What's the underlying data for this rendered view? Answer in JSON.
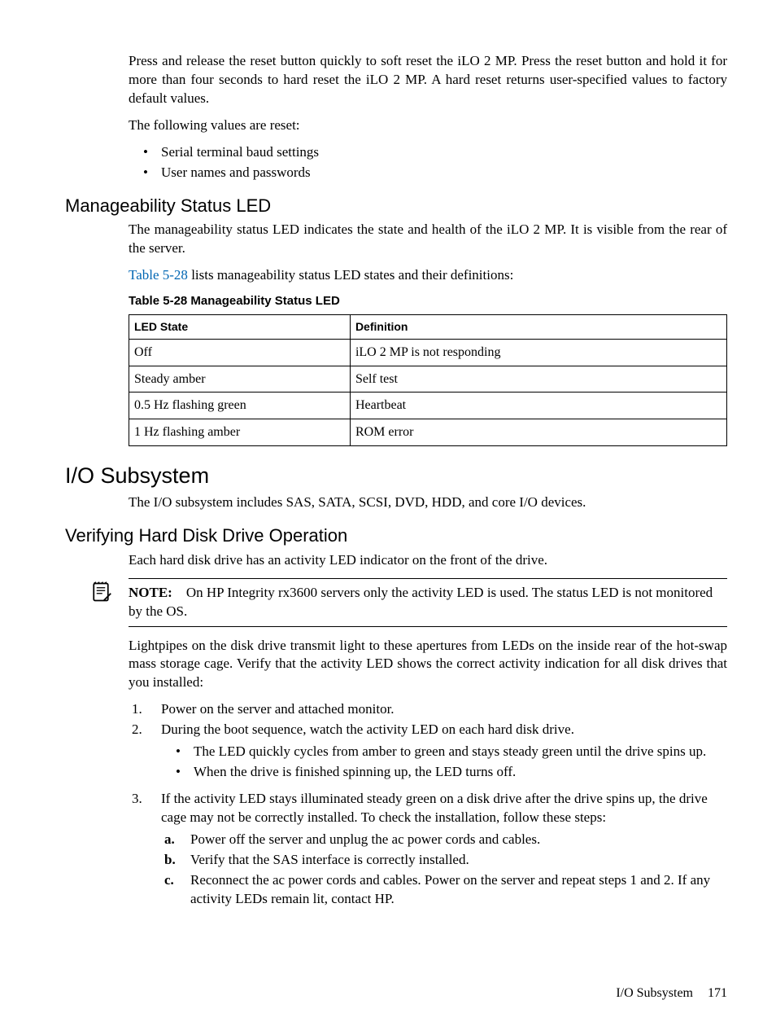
{
  "intro": {
    "p1": "Press and release the reset button quickly to soft reset the iLO 2 MP. Press the reset button and hold it for more than four seconds to hard reset the iLO 2 MP. A hard reset returns user-specified values to factory default values.",
    "p2": "The following values are reset:",
    "bullets": [
      "Serial terminal baud settings",
      "User names and passwords"
    ]
  },
  "mled": {
    "heading": "Manageability Status LED",
    "p1": "The manageability status LED indicates the state and health of the iLO 2 MP. It is visible from the rear of the server.",
    "p2_pre": "Table 5-28",
    "p2_post": " lists manageability status LED states and their definitions:",
    "table_caption": "Table 5-28 Manageability Status LED",
    "header_state": "LED State",
    "header_def": "Definition",
    "rows": [
      {
        "state": "Off",
        "def": "iLO 2 MP is not responding"
      },
      {
        "state": "Steady amber",
        "def": "Self test"
      },
      {
        "state": "0.5 Hz flashing green",
        "def": "Heartbeat"
      },
      {
        "state": "1 Hz flashing amber",
        "def": "ROM error"
      }
    ]
  },
  "io": {
    "heading": "I/O Subsystem",
    "p1": "The I/O subsystem includes SAS, SATA, SCSI, DVD, HDD, and core I/O devices."
  },
  "hdd": {
    "heading": "Verifying Hard Disk Drive Operation",
    "p1": "Each hard disk drive has an activity LED indicator on the front of the drive.",
    "note_label": "NOTE:",
    "note_text": "On HP Integrity rx3600 servers only the activity LED is used. The status LED is not monitored by the OS.",
    "p2": "Lightpipes on the disk drive transmit light to these apertures from LEDs on the inside rear of the hot-swap mass storage cage. Verify that the activity LED shows the correct activity indication for all disk drives that you installed:",
    "step1": "Power on the server and attached monitor.",
    "step2": "During the boot sequence, watch the activity LED on each hard disk drive.",
    "step2_b1": "The LED quickly cycles from amber to green and stays steady green until the drive spins up.",
    "step2_b2": "When the drive is finished spinning up, the LED turns off.",
    "step3": "If the activity LED stays illuminated steady green on a disk drive after the drive spins up, the drive cage may not be correctly installed. To check the installation, follow these steps:",
    "step3_a": "Power off the server and unplug the ac power cords and cables.",
    "step3_b": "Verify that the SAS interface is correctly installed.",
    "step3_c": "Reconnect the ac power cords and cables. Power on the server and repeat steps 1 and 2. If any activity LEDs remain lit, contact HP."
  },
  "footer": {
    "section": "I/O Subsystem",
    "page": "171"
  }
}
